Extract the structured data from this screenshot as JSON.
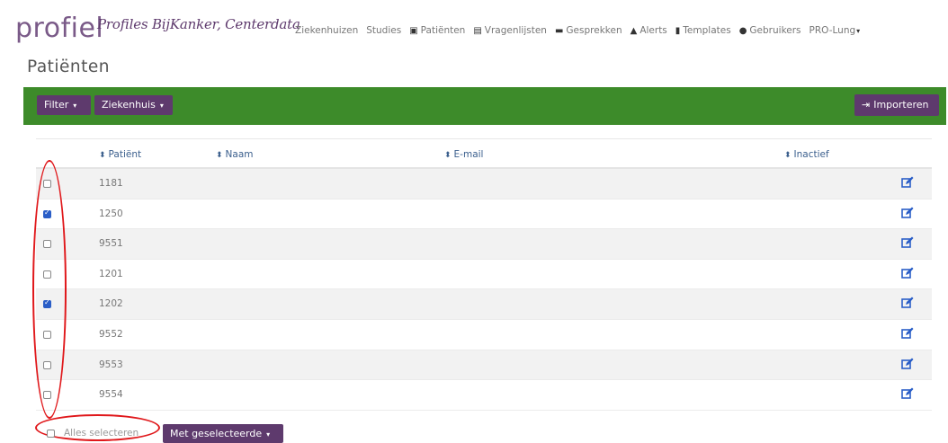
{
  "header": {
    "logo": "profiel",
    "logo_sub": "Profiles BijKanker, Centerdata",
    "nav": [
      {
        "label": "Ziekenhuizen",
        "icon": ""
      },
      {
        "label": "Studies",
        "icon": ""
      },
      {
        "label": "Patiënten",
        "icon": "patient-icon"
      },
      {
        "label": "Vragenlijsten",
        "icon": "questionnaire-icon"
      },
      {
        "label": "Gesprekken",
        "icon": "chat-icon"
      },
      {
        "label": "Alerts",
        "icon": "bell-icon"
      },
      {
        "label": "Templates",
        "icon": "template-icon"
      },
      {
        "label": "Gebruikers",
        "icon": "user-icon"
      },
      {
        "label": "PRO-Lung",
        "icon": ""
      }
    ]
  },
  "page": {
    "title": "Patiënten"
  },
  "toolbar": {
    "filter_label": "Filter",
    "hospital_label": "Ziekenhuis",
    "import_label": "Importeren"
  },
  "table": {
    "columns": [
      "Patiënt",
      "Naam",
      "E-mail",
      "Inactief"
    ],
    "rows": [
      {
        "id": "1181",
        "checked": false
      },
      {
        "id": "1250",
        "checked": true
      },
      {
        "id": "9551",
        "checked": false
      },
      {
        "id": "1201",
        "checked": false
      },
      {
        "id": "1202",
        "checked": true
      },
      {
        "id": "9552",
        "checked": false
      },
      {
        "id": "9553",
        "checked": false
      },
      {
        "id": "9554",
        "checked": false
      }
    ]
  },
  "footer": {
    "select_all_label": "Alles selecteren",
    "with_selected_label": "Met geselecteerde"
  },
  "colors": {
    "brand_purple": "#5e3a6d",
    "toolbar_green": "#3d8b2a",
    "annotation_red": "#e0181b",
    "header_link_blue": "#3b5f8d"
  }
}
